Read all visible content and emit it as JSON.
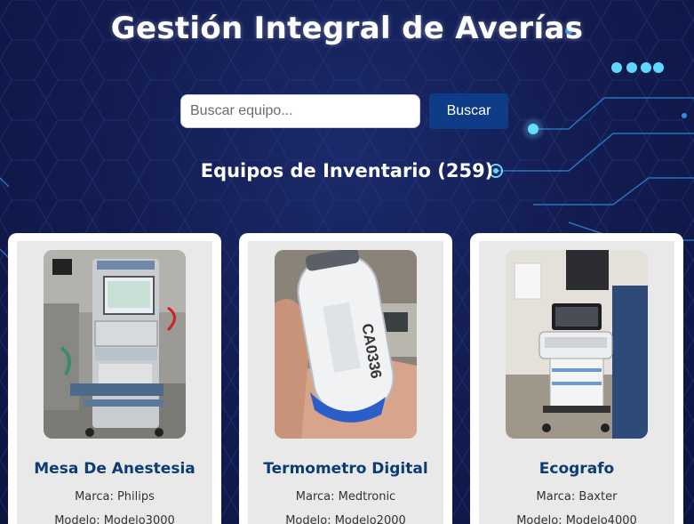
{
  "header": {
    "title": "Gestión Integral de Averías"
  },
  "search": {
    "placeholder": "Buscar equipo...",
    "value": "",
    "button_label": "Buscar"
  },
  "inventory": {
    "title": "Equipos de Inventario (259)"
  },
  "cards": [
    {
      "name": "Mesa De Anestesia",
      "brand": "Marca: Philips",
      "model": "Modelo: Modelo3000"
    },
    {
      "name": "Termometro Digital",
      "brand": "Marca: Medtronic",
      "model": "Modelo: Modelo2000"
    },
    {
      "name": "Ecografo",
      "brand": "Marca: Baxter",
      "model": "Modelo: Modelo4000"
    }
  ],
  "device_label": "CA0336",
  "theme": {
    "accent": "#3fc3ff",
    "button": "#0e3c86",
    "card_title": "#0e3c72"
  }
}
